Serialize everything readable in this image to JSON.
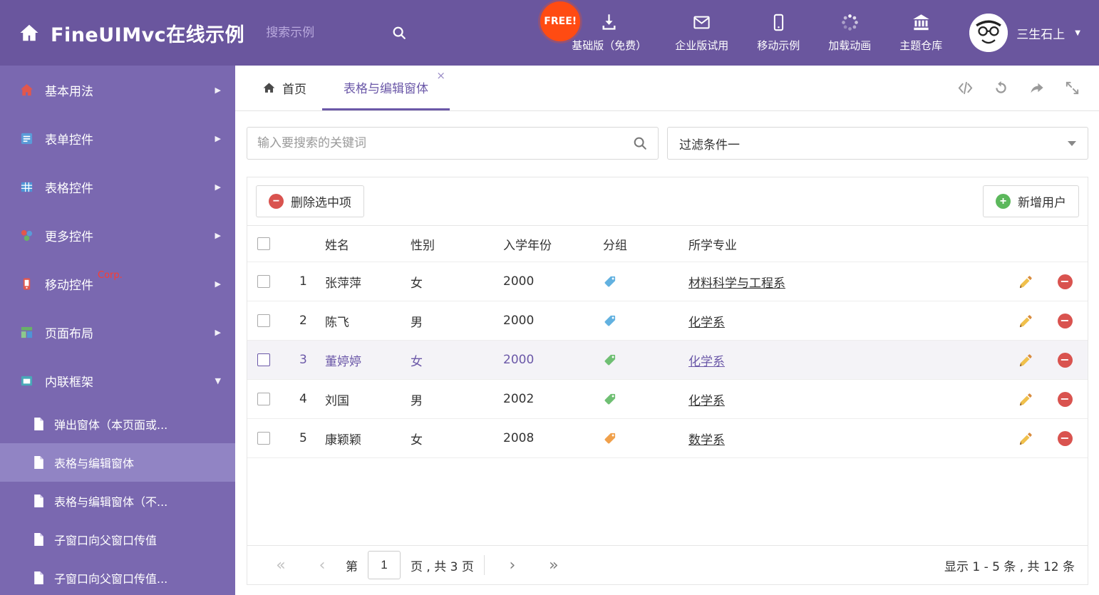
{
  "colors": {
    "accent_purple": "#6b58a8",
    "header_bg": "#6a569e",
    "sidebar_bg": "#7a68b0",
    "sidebar_selected_bg": "#9184c4",
    "free_badge_bg": "#ff4b12",
    "delete_red": "#d9534f",
    "add_green": "#5cb85c",
    "edit_yellow": "#f0c04c",
    "tag_blue": "#62b1e0",
    "tag_green": "#6fbf73",
    "tag_orange": "#f0a04b"
  },
  "icons": {
    "close": "×",
    "chevron_right": "▶",
    "chevron_down": "▼",
    "caret_down": "▼",
    "minus": "−",
    "plus": "+"
  },
  "header": {
    "title": "FineUIMvc在线示例",
    "search_placeholder": "搜索示例",
    "free_badge": "FREE!",
    "nav": [
      {
        "label": "基础版（免费）"
      },
      {
        "label": "企业版试用"
      },
      {
        "label": "移动示例"
      },
      {
        "label": "加载动画"
      },
      {
        "label": "主题仓库"
      }
    ],
    "username": "三生石上"
  },
  "sidebar": {
    "items": [
      {
        "label": "基本用法"
      },
      {
        "label": "表单控件"
      },
      {
        "label": "表格控件"
      },
      {
        "label": "更多控件"
      },
      {
        "label": "移动控件",
        "badge": "Corp."
      },
      {
        "label": "页面布局"
      },
      {
        "label": "内联框架",
        "expanded": true
      }
    ],
    "subitems": [
      {
        "label": "弹出窗体（本页面或..."
      },
      {
        "label": "表格与编辑窗体",
        "active": true
      },
      {
        "label": "表格与编辑窗体（不..."
      },
      {
        "label": "子窗口向父窗口传值"
      },
      {
        "label": "子窗口向父窗口传值..."
      }
    ]
  },
  "tabs": {
    "home": "首页",
    "active": "表格与编辑窗体"
  },
  "filter": {
    "keyword_placeholder": "输入要搜索的关键词",
    "condition_value": "过滤条件一"
  },
  "toolbar": {
    "delete_label": "删除选中项",
    "add_label": "新增用户"
  },
  "table": {
    "headers": {
      "name": "姓名",
      "gender": "性别",
      "year": "入学年份",
      "group": "分组",
      "major": "所学专业"
    },
    "rows": [
      {
        "index": "1",
        "name": "张萍萍",
        "gender": "女",
        "year": "2000",
        "tag_color": "#62b1e0",
        "major": "材料科学与工程系",
        "selected": false
      },
      {
        "index": "2",
        "name": "陈飞",
        "gender": "男",
        "year": "2000",
        "tag_color": "#62b1e0",
        "major": "化学系",
        "selected": false
      },
      {
        "index": "3",
        "name": "董婷婷",
        "gender": "女",
        "year": "2000",
        "tag_color": "#6fbf73",
        "major": "化学系",
        "selected": true
      },
      {
        "index": "4",
        "name": "刘国",
        "gender": "男",
        "year": "2002",
        "tag_color": "#6fbf73",
        "major": "化学系",
        "selected": false
      },
      {
        "index": "5",
        "name": "康颖颖",
        "gender": "女",
        "year": "2008",
        "tag_color": "#f0a04b",
        "major": "数学系",
        "selected": false
      }
    ]
  },
  "pagination": {
    "first": "«",
    "prev": "‹",
    "label_before": "第",
    "page_value": "1",
    "label_after": "页 , 共 3 页",
    "next": "›",
    "last": "»",
    "summary": "显示 1 - 5 条 , 共 12 条"
  }
}
